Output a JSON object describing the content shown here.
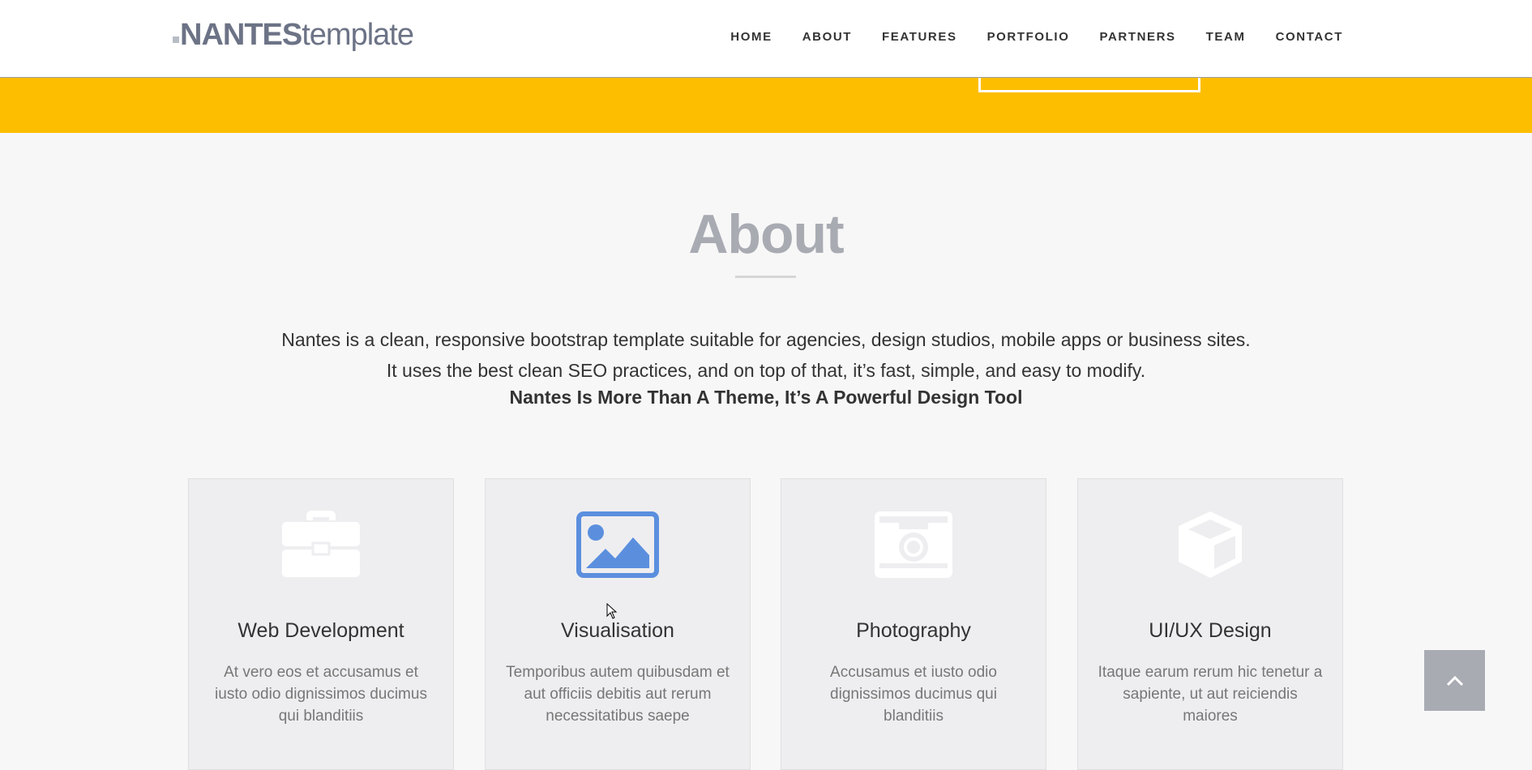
{
  "header": {
    "logo_bold": "NANTES",
    "logo_light": "template",
    "nav": [
      "HOME",
      "ABOUT",
      "FEATURES",
      "PORTFOLIO",
      "PARTNERS",
      "TEAM",
      "CONTACT"
    ]
  },
  "about": {
    "title": "About",
    "text": "Nantes is a clean, responsive bootstrap template suitable for agencies, design studios, mobile apps or business sites. It uses the best clean SEO practices, and on top of that, it’s fast, simple, and easy to modify.",
    "tagline": "Nantes Is More Than A Theme, It’s A Powerful Design Tool"
  },
  "features": [
    {
      "icon": "briefcase-icon",
      "title": "Web Development",
      "desc": "At vero eos et accusamus et iusto odio dignissimos ducimus qui blanditiis"
    },
    {
      "icon": "image-icon",
      "title": "Visualisation",
      "desc": "Temporibus autem quibusdam et aut officiis debitis aut rerum necessitatibus saepe"
    },
    {
      "icon": "camera-icon",
      "title": "Photography",
      "desc": "Accusamus et iusto odio dignissimos ducimus qui blanditiis"
    },
    {
      "icon": "cube-icon",
      "title": "UI/UX Design",
      "desc": "Itaque earum rerum hic tenetur a sapiente, ut aut reiciendis maiores"
    }
  ],
  "colors": {
    "accent_yellow": "#fdbe00",
    "icon_active": "#5b8fde",
    "icon_inactive": "#ffffff",
    "title_grey": "#a9abb3",
    "to_top_bg": "#a9abb3"
  }
}
